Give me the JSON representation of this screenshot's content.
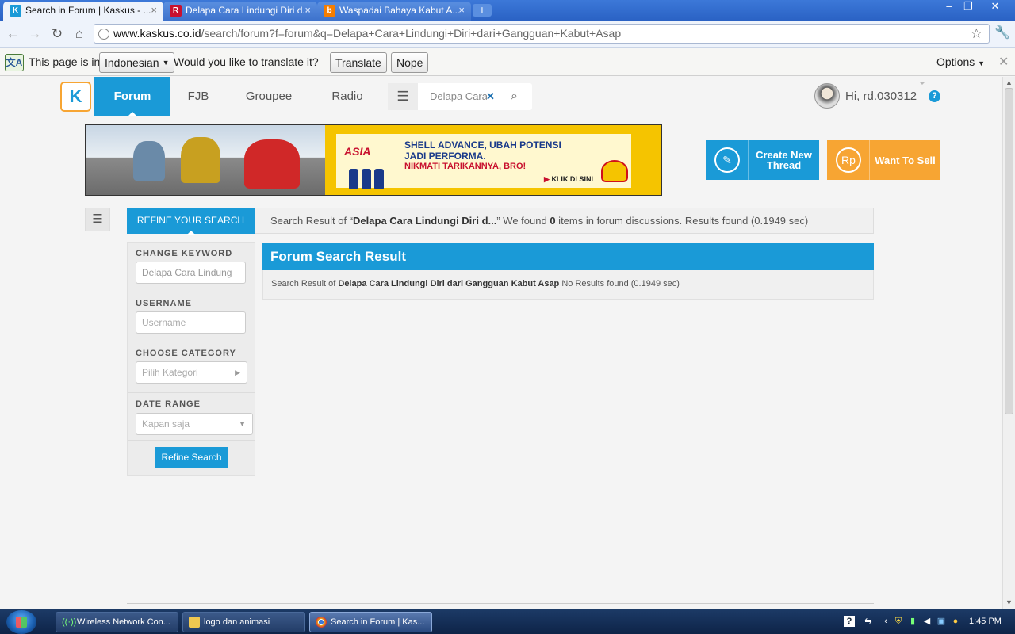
{
  "browser": {
    "tabs": [
      {
        "title": "Search in Forum | Kaskus - ...",
        "active": true,
        "icon": "kaskus-favicon"
      },
      {
        "title": "Delapa Cara Lindungi Diri d...",
        "active": false,
        "icon": "r-favicon"
      },
      {
        "title": "Waspadai Bahaya Kabut A...",
        "active": false,
        "icon": "blogger-favicon"
      }
    ],
    "url_host": "www.kaskus.co.id",
    "url_path": "/search/forum?f=forum&q=Delapa+Cara+Lindungi+Diri+dari+Gangguan+Kabut+Asap",
    "translate_bar": {
      "prefix": "This page is in",
      "language": "Indonesian",
      "question": "Would you like to translate it?",
      "translate_label": "Translate",
      "nope_label": "Nope",
      "options_label": "Options"
    }
  },
  "header": {
    "logo": "K",
    "nav": [
      "Forum",
      "FJB",
      "Groupee",
      "Radio"
    ],
    "search_query": "Delapa Cara",
    "greeting": "Hi, rd.030312",
    "help": "?"
  },
  "banner": {
    "brand": "ASIA",
    "line1": "SHELL ADVANCE, UBAH POTENSI",
    "line1b": "JADI PERFORMA.",
    "line2": "NIKMATI TARIKANNYA, BRO!",
    "cta": "KLIK DI SINI"
  },
  "actions": {
    "create_thread": "Create New Thread",
    "want_to_sell": "Want To Sell",
    "sell_icon": "Rp"
  },
  "search": {
    "refine_tab": "REFINE YOUR SEARCH",
    "summary_prefix": "Search Result of “",
    "summary_query": "Delapa Cara Lindungi Diri d...",
    "summary_mid": "” We found ",
    "summary_count": "0",
    "summary_suffix": " items in forum discussions. Results found (0.1949 sec)",
    "change_keyword_label": "CHANGE KEYWORD",
    "keyword_value": "Delapa Cara Lindung",
    "username_label": "USERNAME",
    "username_placeholder": "Username",
    "category_label": "CHOOSE CATEGORY",
    "category_value": "Pilih Kategori",
    "date_label": "DATE RANGE",
    "date_value": "Kapan saja",
    "refine_button": "Refine Search",
    "result_title": "Forum Search Result",
    "result_prefix": "Search Result of ",
    "result_query": "Delapa Cara Lindungi Diri dari Gangguan Kabut Asap",
    "result_suffix": " No Results found (0.1949 sec)"
  },
  "taskbar": {
    "items": [
      {
        "label": "Wireless Network Con...",
        "icon": "wifi-icon"
      },
      {
        "label": "logo dan animasi",
        "icon": "folder-icon"
      },
      {
        "label": "Search in Forum | Kas...",
        "icon": "chrome-icon"
      }
    ],
    "clock": "1:45 PM"
  },
  "colors": {
    "kaskus_blue": "#1a9ad7",
    "sell_orange": "#f7a533",
    "banner_yellow": "#f5c400"
  }
}
